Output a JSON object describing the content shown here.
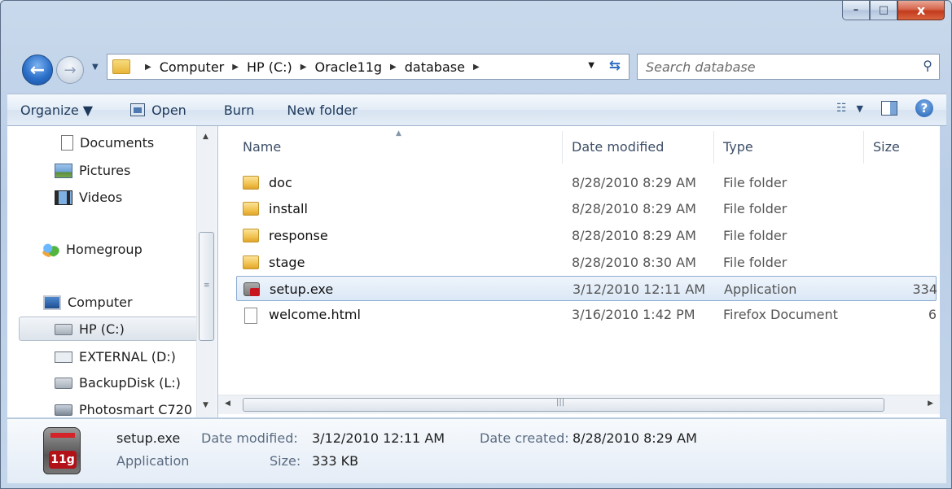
{
  "window": {
    "minimize": "–",
    "maximize": "□",
    "close": "x"
  },
  "address": {
    "crumbs": [
      "Computer",
      "HP (C:)",
      "Oracle11g",
      "database"
    ],
    "search_placeholder": "Search database"
  },
  "toolbar": {
    "organize": "Organize ▼",
    "open": "Open",
    "burn": "Burn",
    "new_folder": "New folder",
    "view_dropdown": "▼",
    "help": "?"
  },
  "navpane": {
    "items": [
      {
        "label": "Documents",
        "icon": "document-icon"
      },
      {
        "label": "Pictures",
        "icon": "pictures-icon"
      },
      {
        "label": "Videos",
        "icon": "videos-icon"
      },
      {
        "label": "Homegroup",
        "icon": "homegroup-icon"
      },
      {
        "label": "Computer",
        "icon": "computer-icon"
      },
      {
        "label": "HP (C:)",
        "icon": "drive-icon",
        "selected": true
      },
      {
        "label": "EXTERNAL (D:)",
        "icon": "external-drive-icon"
      },
      {
        "label": "BackupDisk (L:)",
        "icon": "drive-icon"
      },
      {
        "label": "Photosmart C720",
        "icon": "printer-icon"
      }
    ]
  },
  "columns": {
    "name": "Name",
    "date": "Date modified",
    "type": "Type",
    "size": "Size"
  },
  "files": [
    {
      "name": "doc",
      "date": "8/28/2010 8:29 AM",
      "type": "File folder",
      "size": "",
      "icon": "folder-icon"
    },
    {
      "name": "install",
      "date": "8/28/2010 8:29 AM",
      "type": "File folder",
      "size": "",
      "icon": "folder-icon"
    },
    {
      "name": "response",
      "date": "8/28/2010 8:29 AM",
      "type": "File folder",
      "size": "",
      "icon": "folder-icon"
    },
    {
      "name": "stage",
      "date": "8/28/2010 8:30 AM",
      "type": "File folder",
      "size": "",
      "icon": "folder-icon"
    },
    {
      "name": "setup.exe",
      "date": "3/12/2010 12:11 AM",
      "type": "Application",
      "size": "334",
      "icon": "exe-icon",
      "selected": true
    },
    {
      "name": "welcome.html",
      "date": "3/16/2010 1:42 PM",
      "type": "Firefox Document",
      "size": "6",
      "icon": "html-file-icon"
    }
  ],
  "details": {
    "filename": "setup.exe",
    "filetype": "Application",
    "date_modified_label": "Date modified:",
    "date_modified": "3/12/2010 12:11 AM",
    "date_created_label": "Date created:",
    "date_created": "8/28/2010 8:29 AM",
    "size_label": "Size:",
    "size": "333 KB",
    "icon_badge": "11g"
  }
}
